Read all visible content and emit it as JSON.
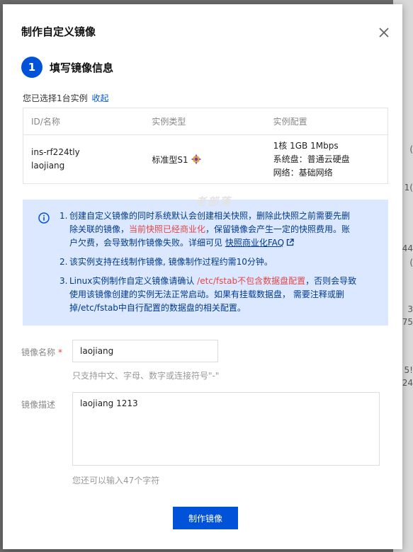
{
  "dialog": {
    "title": "制作自定义镜像",
    "step_number": "1",
    "step_title": "填写镜像信息"
  },
  "selection": {
    "text": "您已选择1台实例",
    "collapse_link": "收起"
  },
  "table": {
    "headers": [
      "ID/名称",
      "实例类型",
      "实例配置"
    ],
    "row": {
      "id": "ins-rf224tly",
      "name": "laojiang",
      "type": "标准型S1",
      "config": [
        "1核 1GB 1Mbps",
        "系统盘：普通云硬盘",
        "网络：基础网络"
      ]
    }
  },
  "watermark": "老部落",
  "notice": {
    "item1": {
      "num": "1.",
      "part1": "创建自定义镜像的同时系统默认会创建相关快照，删除此快照之前需要先删除关联的镜像，",
      "red": "当前快照已经商业化",
      "part2": "，保留镜像会产生一定的快照费用。账户欠费，会导致制作镜像失败。详细可见 ",
      "link": "快照商业化FAQ"
    },
    "item2": {
      "num": "2.",
      "text": "该实例支持在线制作镜像, 镜像制作过程约需10分钟。"
    },
    "item3": {
      "num": "3.",
      "part1": "Linux实例制作自定义镜像请确认 ",
      "red": "/etc/fstab不包含数据盘配置",
      "part2": "，否则会导致使用该镜像创建的实例无法正常启动。如果有挂载数据盘， 需要注释或删掉/etc/fstab中自行配置的数据盘的相关配置。"
    }
  },
  "form": {
    "name_label": "镜像名称",
    "required_mark": "*",
    "name_value": "laojiang",
    "name_hint": "只支持中文、字母、数字或连接符号\"-\"",
    "desc_label": "镜像描述",
    "desc_value": "laojiang 1213",
    "desc_hint": "您还可以输入47个字符"
  },
  "submit_label": "制作镜像",
  "backdrop_chars": [
    "(",
    "1(",
    "44",
    "(",
    "3",
    "75",
    "5!",
    "24"
  ],
  "colors": {
    "primary": "#0052d9",
    "notice_bg": "#dbe8ff",
    "notice_text": "#003a8c",
    "danger": "#e54545"
  }
}
